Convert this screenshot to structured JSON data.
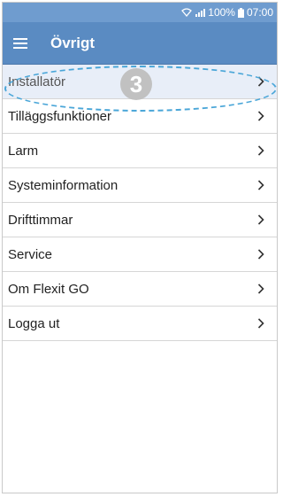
{
  "status_bar": {
    "battery_text": "100%",
    "time": "07:00",
    "icons": [
      "wifi-icon",
      "signal-icon",
      "battery-icon"
    ]
  },
  "app_bar": {
    "title": "Övrigt",
    "menu_icon": "hamburger-menu-icon"
  },
  "menu": {
    "items": [
      {
        "label": "Installatör"
      },
      {
        "label": "Tilläggsfunktioner"
      },
      {
        "label": "Larm"
      },
      {
        "label": "Systeminformation"
      },
      {
        "label": "Drifttimmar"
      },
      {
        "label": "Service"
      },
      {
        "label": "Om Flexit GO"
      },
      {
        "label": "Logga ut"
      }
    ]
  },
  "annotation": {
    "step_number": "3"
  },
  "colors": {
    "status_bar": "#6f9ccf",
    "app_bar": "#5a8bc2",
    "callout": "#4aa6d8",
    "badge": "#bfbfbf"
  }
}
